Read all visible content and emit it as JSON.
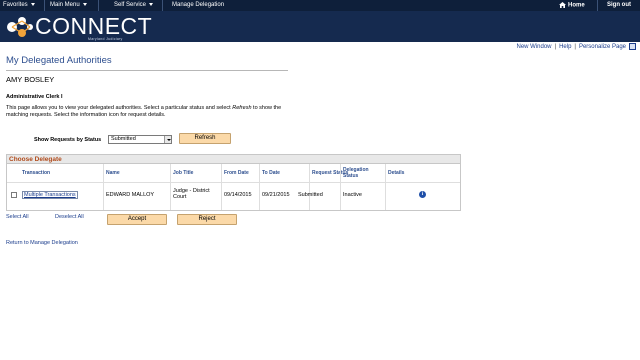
{
  "nav": {
    "favorites": "Favorites",
    "main_menu": "Main Menu",
    "self_service": "Self Service",
    "manage_delegation": "Manage Delegation",
    "home": "Home",
    "sign_out": "Sign out"
  },
  "logo": {
    "word": "CONNECT",
    "sub": "Maryland Judiciary"
  },
  "utility": {
    "new_window": "New Window",
    "help": "Help",
    "personalize": "Personalize Page"
  },
  "page": {
    "title": "My Delegated Authorities",
    "user": "AMY BOSLEY",
    "role": "Administrative Clerk I",
    "description_1": "This page allows you to view your delegated authorities. Select a particular status and select ",
    "description_em": "Refresh",
    "description_2": " to show the matching requests. Select the information icon for request details."
  },
  "filter": {
    "label": "Show Requests by Status",
    "selected": "Submitted",
    "refresh": "Refresh"
  },
  "grid": {
    "title": "Choose Delegate",
    "columns": {
      "transaction": "Transaction",
      "name": "Name",
      "job_title": "Job Title",
      "from_date": "From Date",
      "to_date": "To Date",
      "request_status": "Request Status",
      "delegation_status": "Delegation Status",
      "details": "Details"
    },
    "row": {
      "transaction": "Multiple Transactions",
      "name": "EDWARD MALLOY",
      "job_title": "Judge - District Court",
      "from_date": "09/14/2015",
      "to_date": "09/21/2015",
      "request_status": "Submitted",
      "delegation_status": "Inactive",
      "details_icon": "info-icon"
    }
  },
  "actions": {
    "select_all": "Select All",
    "deselect_all": "Deselect All",
    "accept": "Accept",
    "reject": "Reject",
    "return_link": "Return to Manage Delegation"
  },
  "colors": {
    "nav_bg": "#0e1f3a",
    "banner_bg": "#152a4f",
    "title": "#2e4f8f",
    "button": "#fbd9a8",
    "grid_title": "#b04a1a"
  }
}
